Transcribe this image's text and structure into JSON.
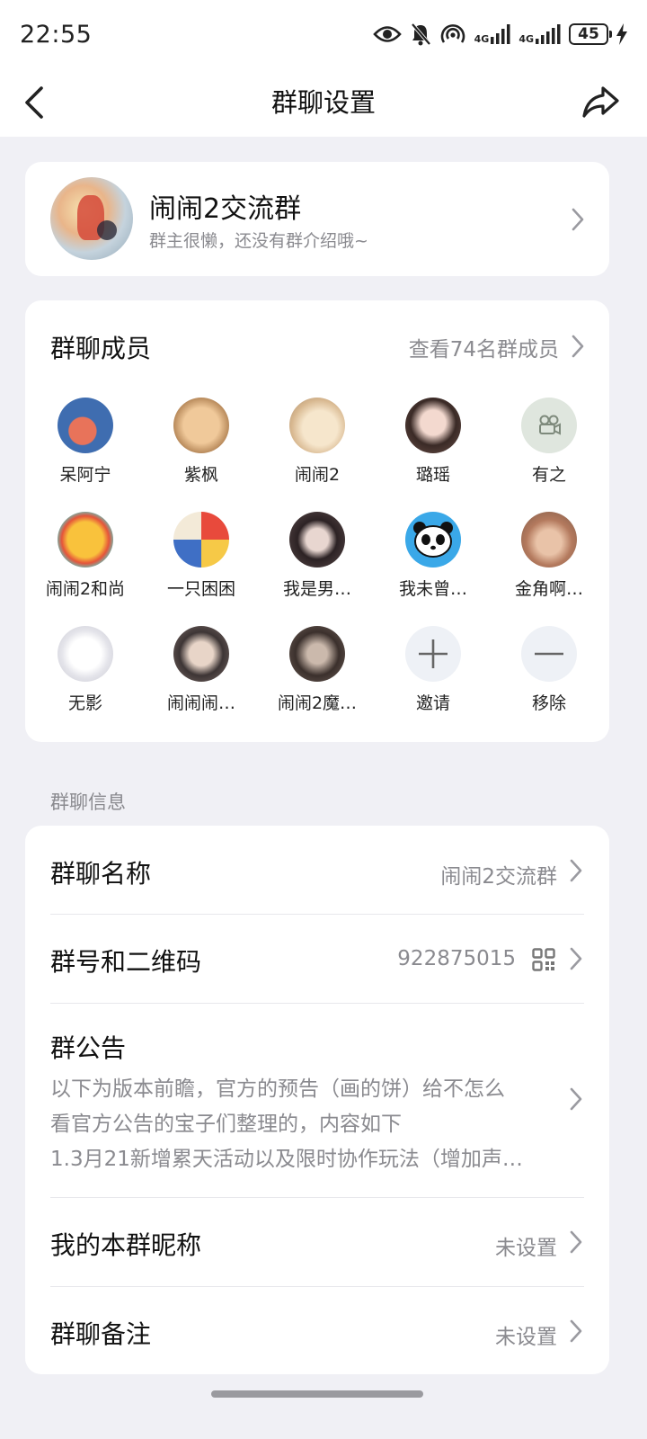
{
  "status_bar": {
    "time": "22:55",
    "network_1": "4G",
    "network_2": "4G",
    "battery": "45"
  },
  "nav": {
    "title": "群聊设置"
  },
  "group": {
    "name": "闹闹2交流群",
    "description": "群主很懒，还没有群介绍哦~"
  },
  "members": {
    "title": "群聊成员",
    "view_all": "查看74名群成员",
    "items": [
      {
        "name": "呆阿宁"
      },
      {
        "name": "紫枫"
      },
      {
        "name": "闹闹2"
      },
      {
        "name": "璐瑶"
      },
      {
        "name": "有之"
      },
      {
        "name": "闹闹2和尚"
      },
      {
        "name": "一只困困"
      },
      {
        "name": "我是男…"
      },
      {
        "name": "我未曾…"
      },
      {
        "name": "金角啊…"
      },
      {
        "name": "无影"
      },
      {
        "name": "闹闹闹…"
      },
      {
        "name": "闹闹2魔…"
      }
    ],
    "invite_label": "邀请",
    "remove_label": "移除"
  },
  "info": {
    "section_label": "群聊信息",
    "name_label": "群聊名称",
    "name_value": "闹闹2交流群",
    "id_label": "群号和二维码",
    "id_value": "922875015",
    "notice_label": "群公告",
    "notice_lines": [
      "以下为版本前瞻，官方的预告（画的饼）给不怎么",
      "看官方公告的宝子们整理的，内容如下",
      "1.3月21新增累天活动以及限时协作玩法（增加声…"
    ],
    "nickname_label": "我的本群昵称",
    "nickname_value": "未设置",
    "remark_label": "群聊备注",
    "remark_value": "未设置"
  }
}
